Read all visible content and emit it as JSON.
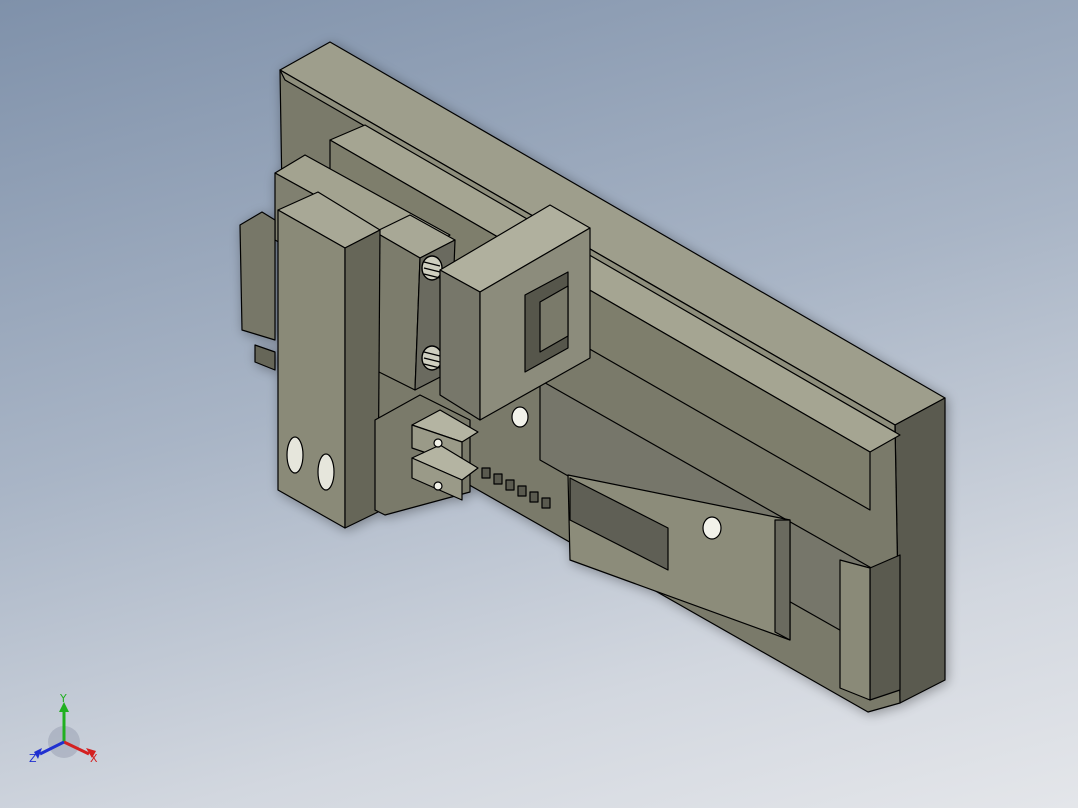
{
  "view": {
    "type": "CAD isometric viewport",
    "background_top": "#7f91aa",
    "background_bottom": "#e4e6ea",
    "part_color": "#8a8a78",
    "edge_color": "#000000"
  },
  "triad": {
    "x_label": "X",
    "y_label": "Y",
    "z_label": "Z",
    "x_color": "#d42020",
    "y_color": "#20b020",
    "z_color": "#2030d0"
  }
}
